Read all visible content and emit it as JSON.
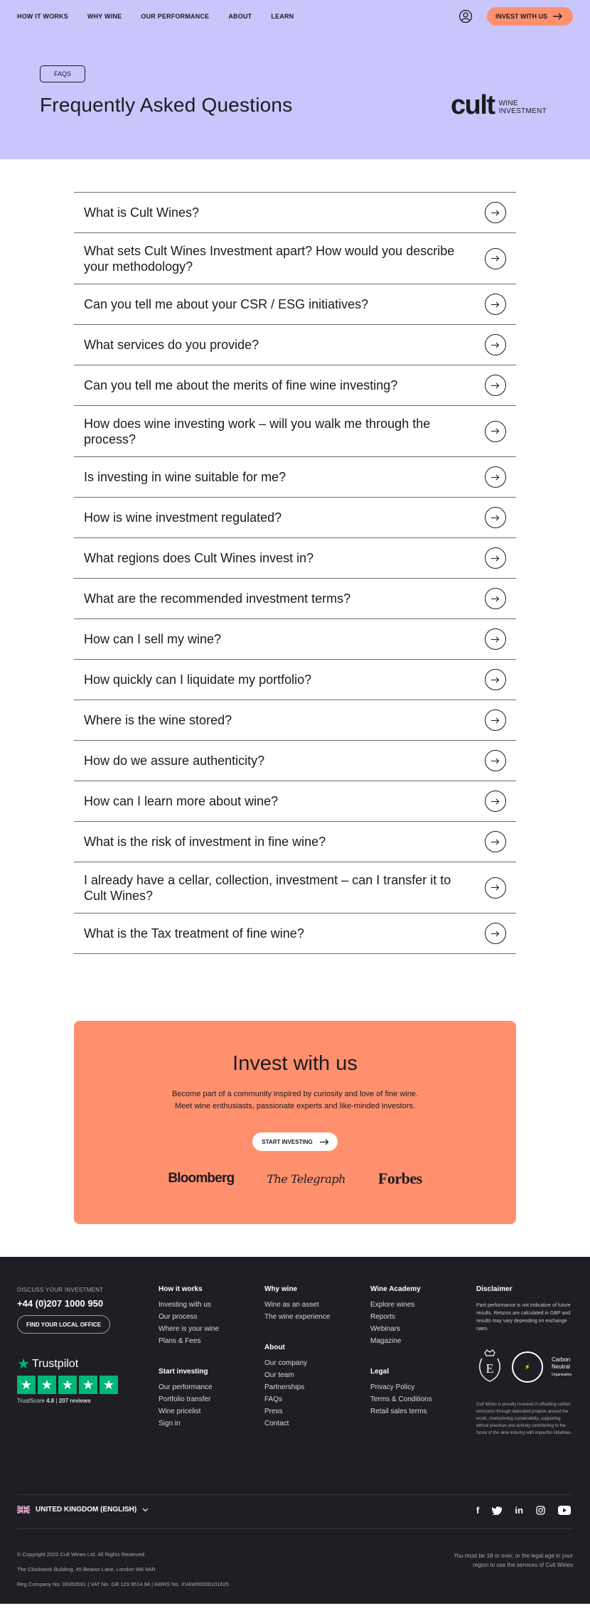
{
  "nav": {
    "links": [
      "HOW IT WORKS",
      "WHY WINE",
      "OUR PERFORMANCE",
      "ABOUT",
      "LEARN"
    ],
    "cta": "INVEST WITH US",
    "account_icon": "user-circle-icon"
  },
  "hero": {
    "pill": "FAQS",
    "title": "Frequently Asked Questions",
    "brand_main": "cult",
    "brand_sub_1": "WINE",
    "brand_sub_2": "INVESTMENT",
    "background": "#c9c6fb"
  },
  "faqs": [
    "What is Cult Wines?",
    "What sets Cult Wines Investment apart? How would you describe your methodology?",
    "Can you tell me about your CSR / ESG initiatives?",
    "What services do you provide?",
    "Can you tell me about the merits of fine wine investing?",
    "How does wine investing work – will you walk me through the process?",
    "Is investing in wine suitable for me?",
    "How is wine investment regulated?",
    "What regions does Cult Wines invest in?",
    "What are the recommended investment terms?",
    "How can I sell my wine?",
    "How quickly can I liquidate my portfolio?",
    "Where is the wine stored?",
    "How do we assure authenticity?",
    "How can I learn more about wine?",
    "What is the risk of investment in fine wine?",
    "I already have a cellar, collection, investment – can I transfer it to Cult Wines?",
    "What is the Tax treatment of fine wine?"
  ],
  "invest": {
    "title": "Invest with us",
    "line1": "Become part of a community inspired by curiosity and love of fine wine.",
    "line2": "Meet wine enthusiasts, passionate experts and like-minded investors.",
    "button": "START INVESTING",
    "press": [
      "Bloomberg",
      "The Telegraph",
      "Forbes"
    ],
    "accent": "#ff906d"
  },
  "footer": {
    "discuss": "DISCUSS YOUR INVESTMENT",
    "phone": "+44 (0)207 1000 950",
    "office_button": "FIND YOUR LOCAL OFFICE",
    "trustpilot": {
      "brand": "Trustpilot",
      "score_label": "TrustScore",
      "score": "4.8",
      "reviews": "207 reviews",
      "stars": 5
    },
    "how_it_works": {
      "title": "How it works",
      "links": [
        "Investing with us",
        "Our process",
        "Where is your wine",
        "Plans & Fees"
      ]
    },
    "start_investing": {
      "title": "Start investing",
      "links": [
        "Our performance",
        "Portfolio transfer",
        "Wine pricelist",
        "Sign in"
      ]
    },
    "why_wine": {
      "title": "Why wine",
      "links": [
        "Wine as an asset",
        "The wine experience"
      ]
    },
    "about": {
      "title": "About",
      "links": [
        "Our company",
        "Our team",
        "Partnerships",
        "FAQs",
        "Press",
        "Contact"
      ]
    },
    "academy": {
      "title": "Wine Academy",
      "links": [
        "Explore wines",
        "Reports",
        "Webinars",
        "Magazine"
      ]
    },
    "legal": {
      "title": "Legal",
      "links": [
        "Privacy Policy",
        "Terms & Conditions",
        "Retail sales terms"
      ]
    },
    "disclaimer": {
      "title": "Disclaimer",
      "text": "Past performance is not indicative of future results. Returns are calculated in GBP and results may vary depending on exchange rates.",
      "carbon_1": "Carbon",
      "carbon_2": "Neutral",
      "carbon_3": "Organisation",
      "offset_text": "Cult Wines is proudly invested in offsetting carbon emissions through dedicated projects around the world, championing sustainability, supporting ethical practices and actively contributing to the future of the wine industry with impactful initiatives."
    },
    "language": "UNITED KINGDOM (ENGLISH)",
    "social": [
      "facebook-icon",
      "twitter-icon",
      "linkedin-icon",
      "instagram-icon",
      "youtube-icon"
    ],
    "copyright": "© Copyright 2022 Cult Wines Ltd. All Rights Reserved.",
    "address": "The Clockwork Building, 45 Beavor Lane, London W6 9AR",
    "reg": "Reg Company No. 06350591 | VAT No. GB 129 9514 84 | AWRS No. XVAW00000101625",
    "age_note": "You must be 18 or over, or the legal age in your region to use the services of Cult Wines",
    "background": "#1e1e24"
  }
}
